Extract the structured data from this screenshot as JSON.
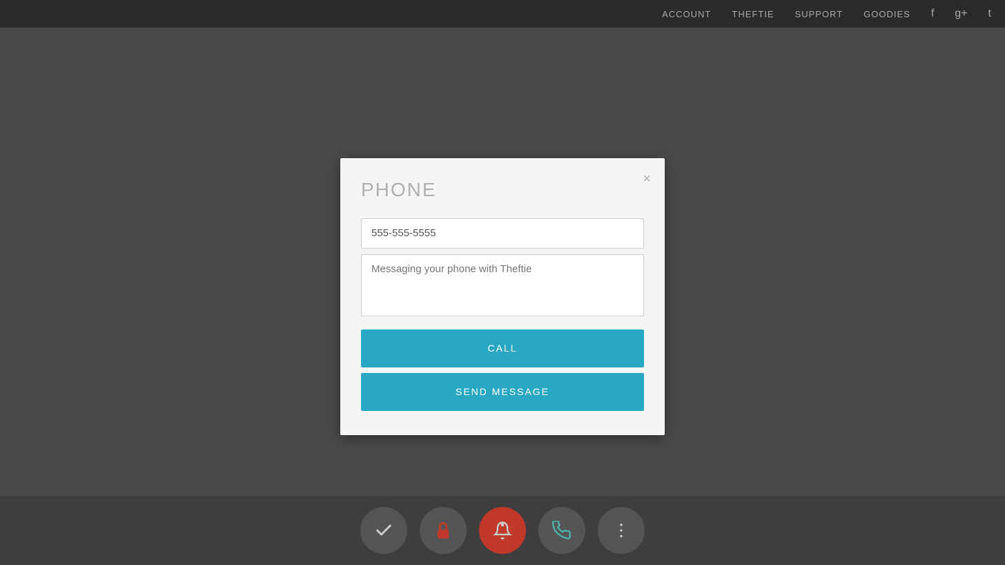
{
  "nav": {
    "items": [
      {
        "id": "account",
        "label": "ACCOUNT"
      },
      {
        "id": "theftie",
        "label": "THEFTIE"
      },
      {
        "id": "support",
        "label": "SUPPORT"
      },
      {
        "id": "goodies",
        "label": "GOODIES"
      }
    ],
    "social": [
      {
        "id": "facebook",
        "icon": "f"
      },
      {
        "id": "googleplus",
        "icon": "g+"
      },
      {
        "id": "twitter",
        "icon": "t"
      }
    ]
  },
  "modal": {
    "title": "PHONE",
    "close_label": "×",
    "phone_value": "555-555-5555",
    "phone_placeholder": "555-555-5555",
    "message_placeholder": "Messaging your phone with Theftie",
    "call_label": "CALL",
    "send_label": "SEND MESSAGE"
  },
  "toolbar": {
    "buttons": [
      {
        "id": "check",
        "icon": "✓",
        "active": false
      },
      {
        "id": "lock",
        "icon": "🔒",
        "active": false
      },
      {
        "id": "alarm",
        "icon": "🔔",
        "active": true
      },
      {
        "id": "phone",
        "icon": "📞",
        "active": false
      },
      {
        "id": "more",
        "icon": "⋮",
        "active": false
      }
    ]
  },
  "colors": {
    "accent": "#29a8c4",
    "nav_bg": "#2a2a2a",
    "modal_bg": "#f5f5f5",
    "bg": "#4a4a4a"
  }
}
